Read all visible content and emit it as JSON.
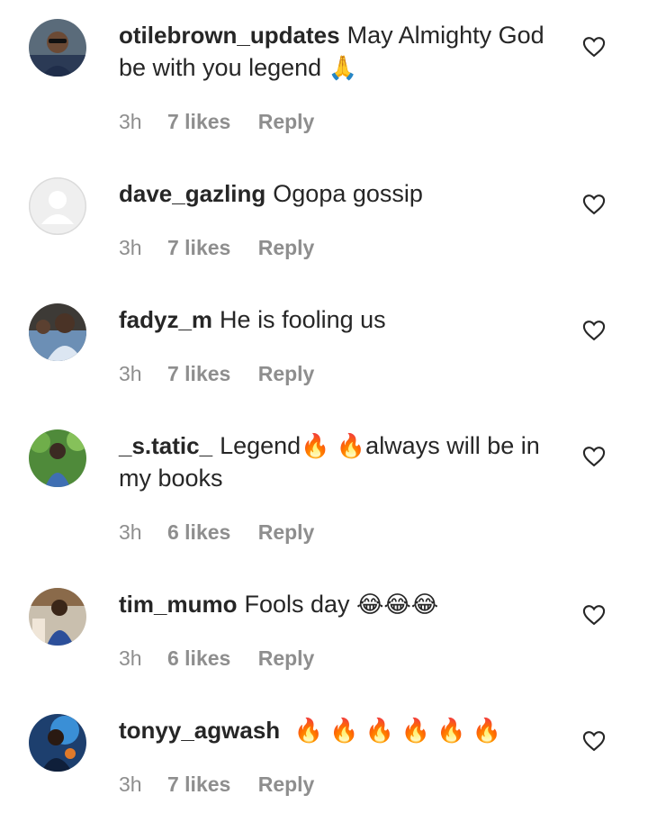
{
  "comments": [
    {
      "username": "otilebrown_updates",
      "text": "May Almighty God be with you legend",
      "emoji": "🙏",
      "time": "3h",
      "likes": "7 likes",
      "reply": "Reply"
    },
    {
      "username": "dave_gazling",
      "text": "Ogopa gossip",
      "emoji": "",
      "time": "3h",
      "likes": "7 likes",
      "reply": "Reply"
    },
    {
      "username": "fadyz_m",
      "text": "He is fooling us",
      "emoji": "",
      "time": "3h",
      "likes": "7 likes",
      "reply": "Reply"
    },
    {
      "username": "_s.tatic_",
      "text_before": "Legend",
      "emoji": "🔥 🔥",
      "text_after": "always will be in my books",
      "time": "3h",
      "likes": "6 likes",
      "reply": "Reply"
    },
    {
      "username": "tim_mumo",
      "text": "Fools day",
      "emoji": "😂😂😂",
      "time": "3h",
      "likes": "6 likes",
      "reply": "Reply"
    },
    {
      "username": "tonyy_agwash",
      "text": "",
      "emoji": "🔥 🔥 🔥 🔥 🔥 🔥",
      "time": "3h",
      "likes": "7 likes",
      "reply": "Reply"
    }
  ],
  "icons": {
    "like": "heart-outline-icon"
  }
}
